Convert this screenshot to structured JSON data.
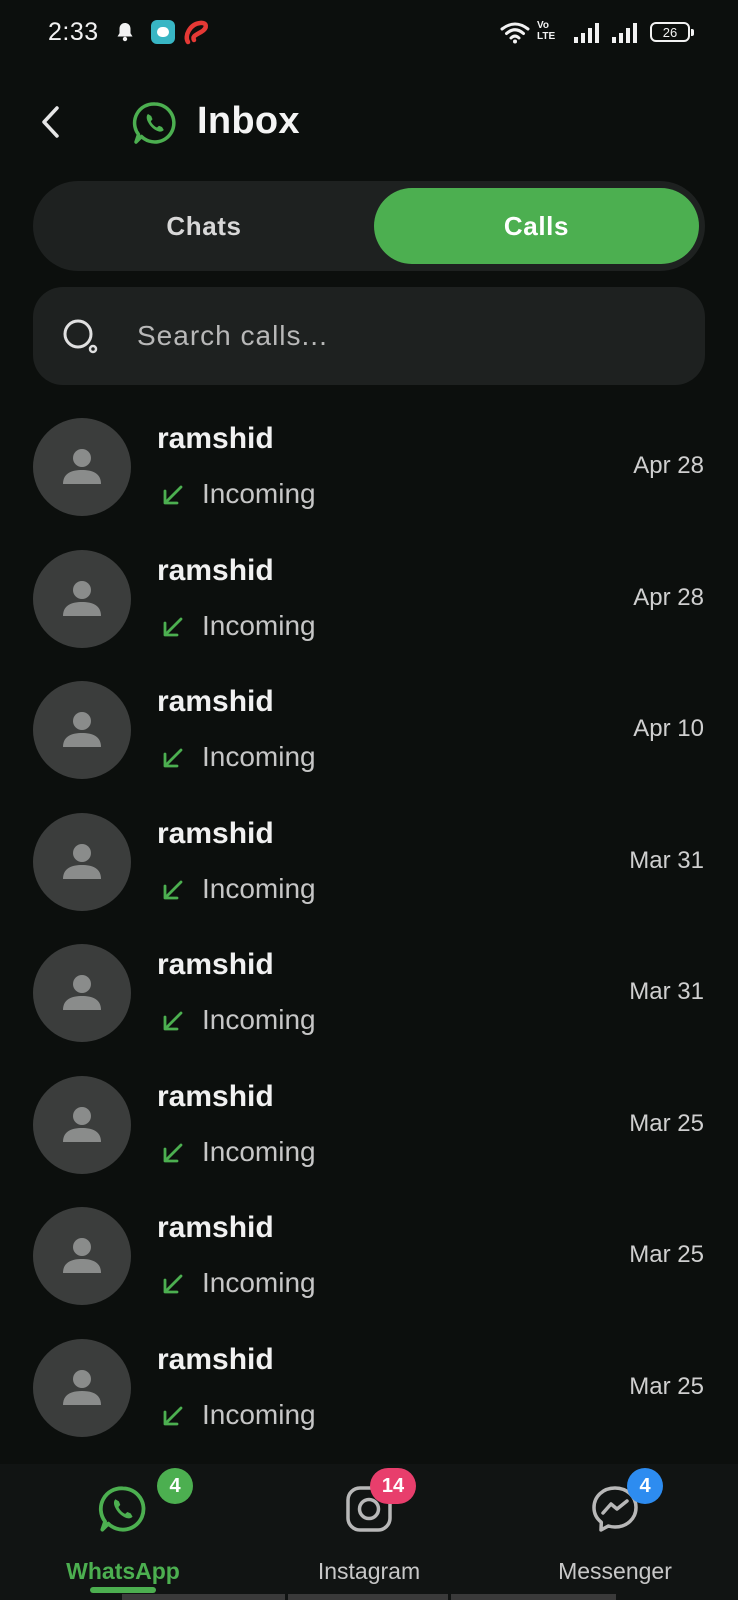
{
  "status_bar": {
    "time": "2:33",
    "network_label": "Vo LTE",
    "battery": "26"
  },
  "header": {
    "title": "Inbox",
    "icons": {
      "back": "chevron-left-icon",
      "logo": "whatsapp-icon"
    }
  },
  "tabs": [
    {
      "label": "Chats",
      "active": false
    },
    {
      "label": "Calls",
      "active": true
    }
  ],
  "search": {
    "placeholder": "Search calls...",
    "value": ""
  },
  "calls": [
    {
      "name": "ramshid",
      "type": "Incoming",
      "date": "Apr 28"
    },
    {
      "name": "ramshid",
      "type": "Incoming",
      "date": "Apr 28"
    },
    {
      "name": "ramshid",
      "type": "Incoming",
      "date": "Apr 10"
    },
    {
      "name": "ramshid",
      "type": "Incoming",
      "date": "Mar 31"
    },
    {
      "name": "ramshid",
      "type": "Incoming",
      "date": "Mar 31"
    },
    {
      "name": "ramshid",
      "type": "Incoming",
      "date": "Mar 25"
    },
    {
      "name": "ramshid",
      "type": "Incoming",
      "date": "Mar 25"
    },
    {
      "name": "ramshid",
      "type": "Incoming",
      "date": "Mar 25"
    }
  ],
  "bottom_nav": [
    {
      "label": "WhatsApp",
      "badge": "4",
      "active": true,
      "icon": "whatsapp-icon"
    },
    {
      "label": "Instagram",
      "badge": "14",
      "active": false,
      "icon": "instagram-icon"
    },
    {
      "label": "Messenger",
      "badge": "4",
      "active": false,
      "icon": "messenger-icon"
    }
  ],
  "colors": {
    "background": "#0c0f0d",
    "accent": "#4caf50",
    "surface": "#1e2120",
    "instagram_badge": "#e83e6c",
    "messenger_badge": "#2d8cf0"
  }
}
